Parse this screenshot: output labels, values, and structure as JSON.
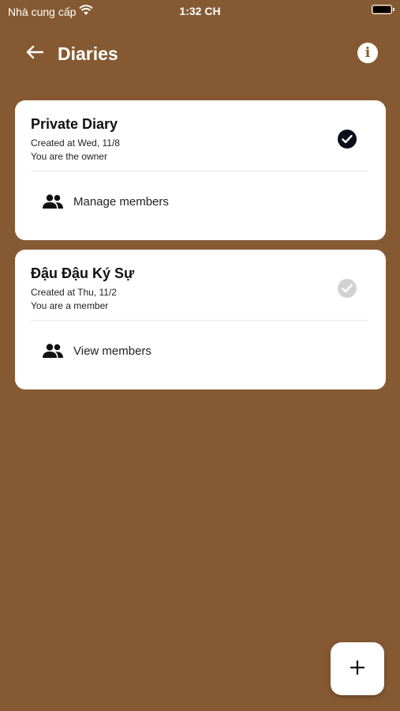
{
  "status_bar": {
    "carrier": "Nhà cung cấp",
    "time": "1:32 CH"
  },
  "app_bar": {
    "title": "Diaries",
    "back_icon": "arrow-left-icon",
    "info_icon": "info-icon"
  },
  "diaries": [
    {
      "name": "Private Diary",
      "created": "Created at Wed, 11/8",
      "role": "You are the owner",
      "selected": true,
      "members_action": "Manage members"
    },
    {
      "name": "Đậu Đậu Ký Sự",
      "created": "Created at Thu, 11/2",
      "role": "You are a member",
      "selected": false,
      "members_action": "View members"
    }
  ],
  "fab": {
    "icon": "plus-icon"
  },
  "colors": {
    "background": "#855A33",
    "card": "#FFFFFF",
    "check_active": "#0D0D1A",
    "check_inactive": "#D2D2D2"
  }
}
